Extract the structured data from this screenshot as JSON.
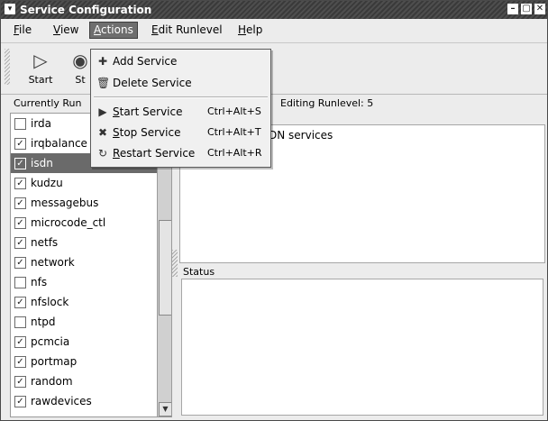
{
  "window": {
    "title": "Service Configuration",
    "controls": {
      "minimize": "–",
      "maximize": "▢",
      "close": "✕"
    },
    "menu_icon": "▾"
  },
  "menubar": {
    "file": {
      "u": "F",
      "rest": "ile"
    },
    "view": {
      "u": "V",
      "rest": "iew"
    },
    "actions": {
      "u": "A",
      "rest": "ctions"
    },
    "edit_runlevel": {
      "u": "E",
      "rest": "dit Runlevel"
    },
    "help": {
      "u": "H",
      "rest": "elp"
    }
  },
  "toolbar": {
    "start_label": "Start",
    "stop_label": "St",
    "start_icon": "▷",
    "stop_icon": "◉"
  },
  "labels": {
    "currently": "Currently Run",
    "editing": "Editing Runlevel: 5",
    "status": "Status",
    "description_partial": "DN services"
  },
  "services": [
    {
      "name": "irda",
      "checked": false,
      "selected": false
    },
    {
      "name": "irqbalance",
      "checked": true,
      "selected": false
    },
    {
      "name": "isdn",
      "checked": true,
      "selected": true
    },
    {
      "name": "kudzu",
      "checked": true,
      "selected": false
    },
    {
      "name": "messagebus",
      "checked": true,
      "selected": false
    },
    {
      "name": "microcode_ctl",
      "checked": true,
      "selected": false
    },
    {
      "name": "netfs",
      "checked": true,
      "selected": false
    },
    {
      "name": "network",
      "checked": true,
      "selected": false
    },
    {
      "name": "nfs",
      "checked": false,
      "selected": false
    },
    {
      "name": "nfslock",
      "checked": true,
      "selected": false
    },
    {
      "name": "ntpd",
      "checked": false,
      "selected": false
    },
    {
      "name": "pcmcia",
      "checked": true,
      "selected": false
    },
    {
      "name": "portmap",
      "checked": true,
      "selected": false
    },
    {
      "name": "random",
      "checked": true,
      "selected": false
    },
    {
      "name": "rawdevices",
      "checked": true,
      "selected": false
    }
  ],
  "actions_menu": {
    "add_service": {
      "icon": "add-icon",
      "glyph": "✚",
      "label": "Add Service"
    },
    "delete_service": {
      "icon": "trash-icon",
      "glyph": "🗑",
      "label": "Delete Service"
    },
    "start_service": {
      "icon": "play-icon",
      "glyph": "▶",
      "u": "S",
      "rest": "tart Service",
      "accel": "Ctrl+Alt+S"
    },
    "stop_service": {
      "icon": "stop-icon",
      "glyph": "✖",
      "u": "S",
      "rest": "top Service",
      "accel": "Ctrl+Alt+T"
    },
    "restart_service": {
      "icon": "restart-icon",
      "glyph": "↻",
      "u": "R",
      "rest": "estart Service",
      "accel": "Ctrl+Alt+R"
    }
  },
  "scroll": {
    "down_arrow": "▼"
  }
}
